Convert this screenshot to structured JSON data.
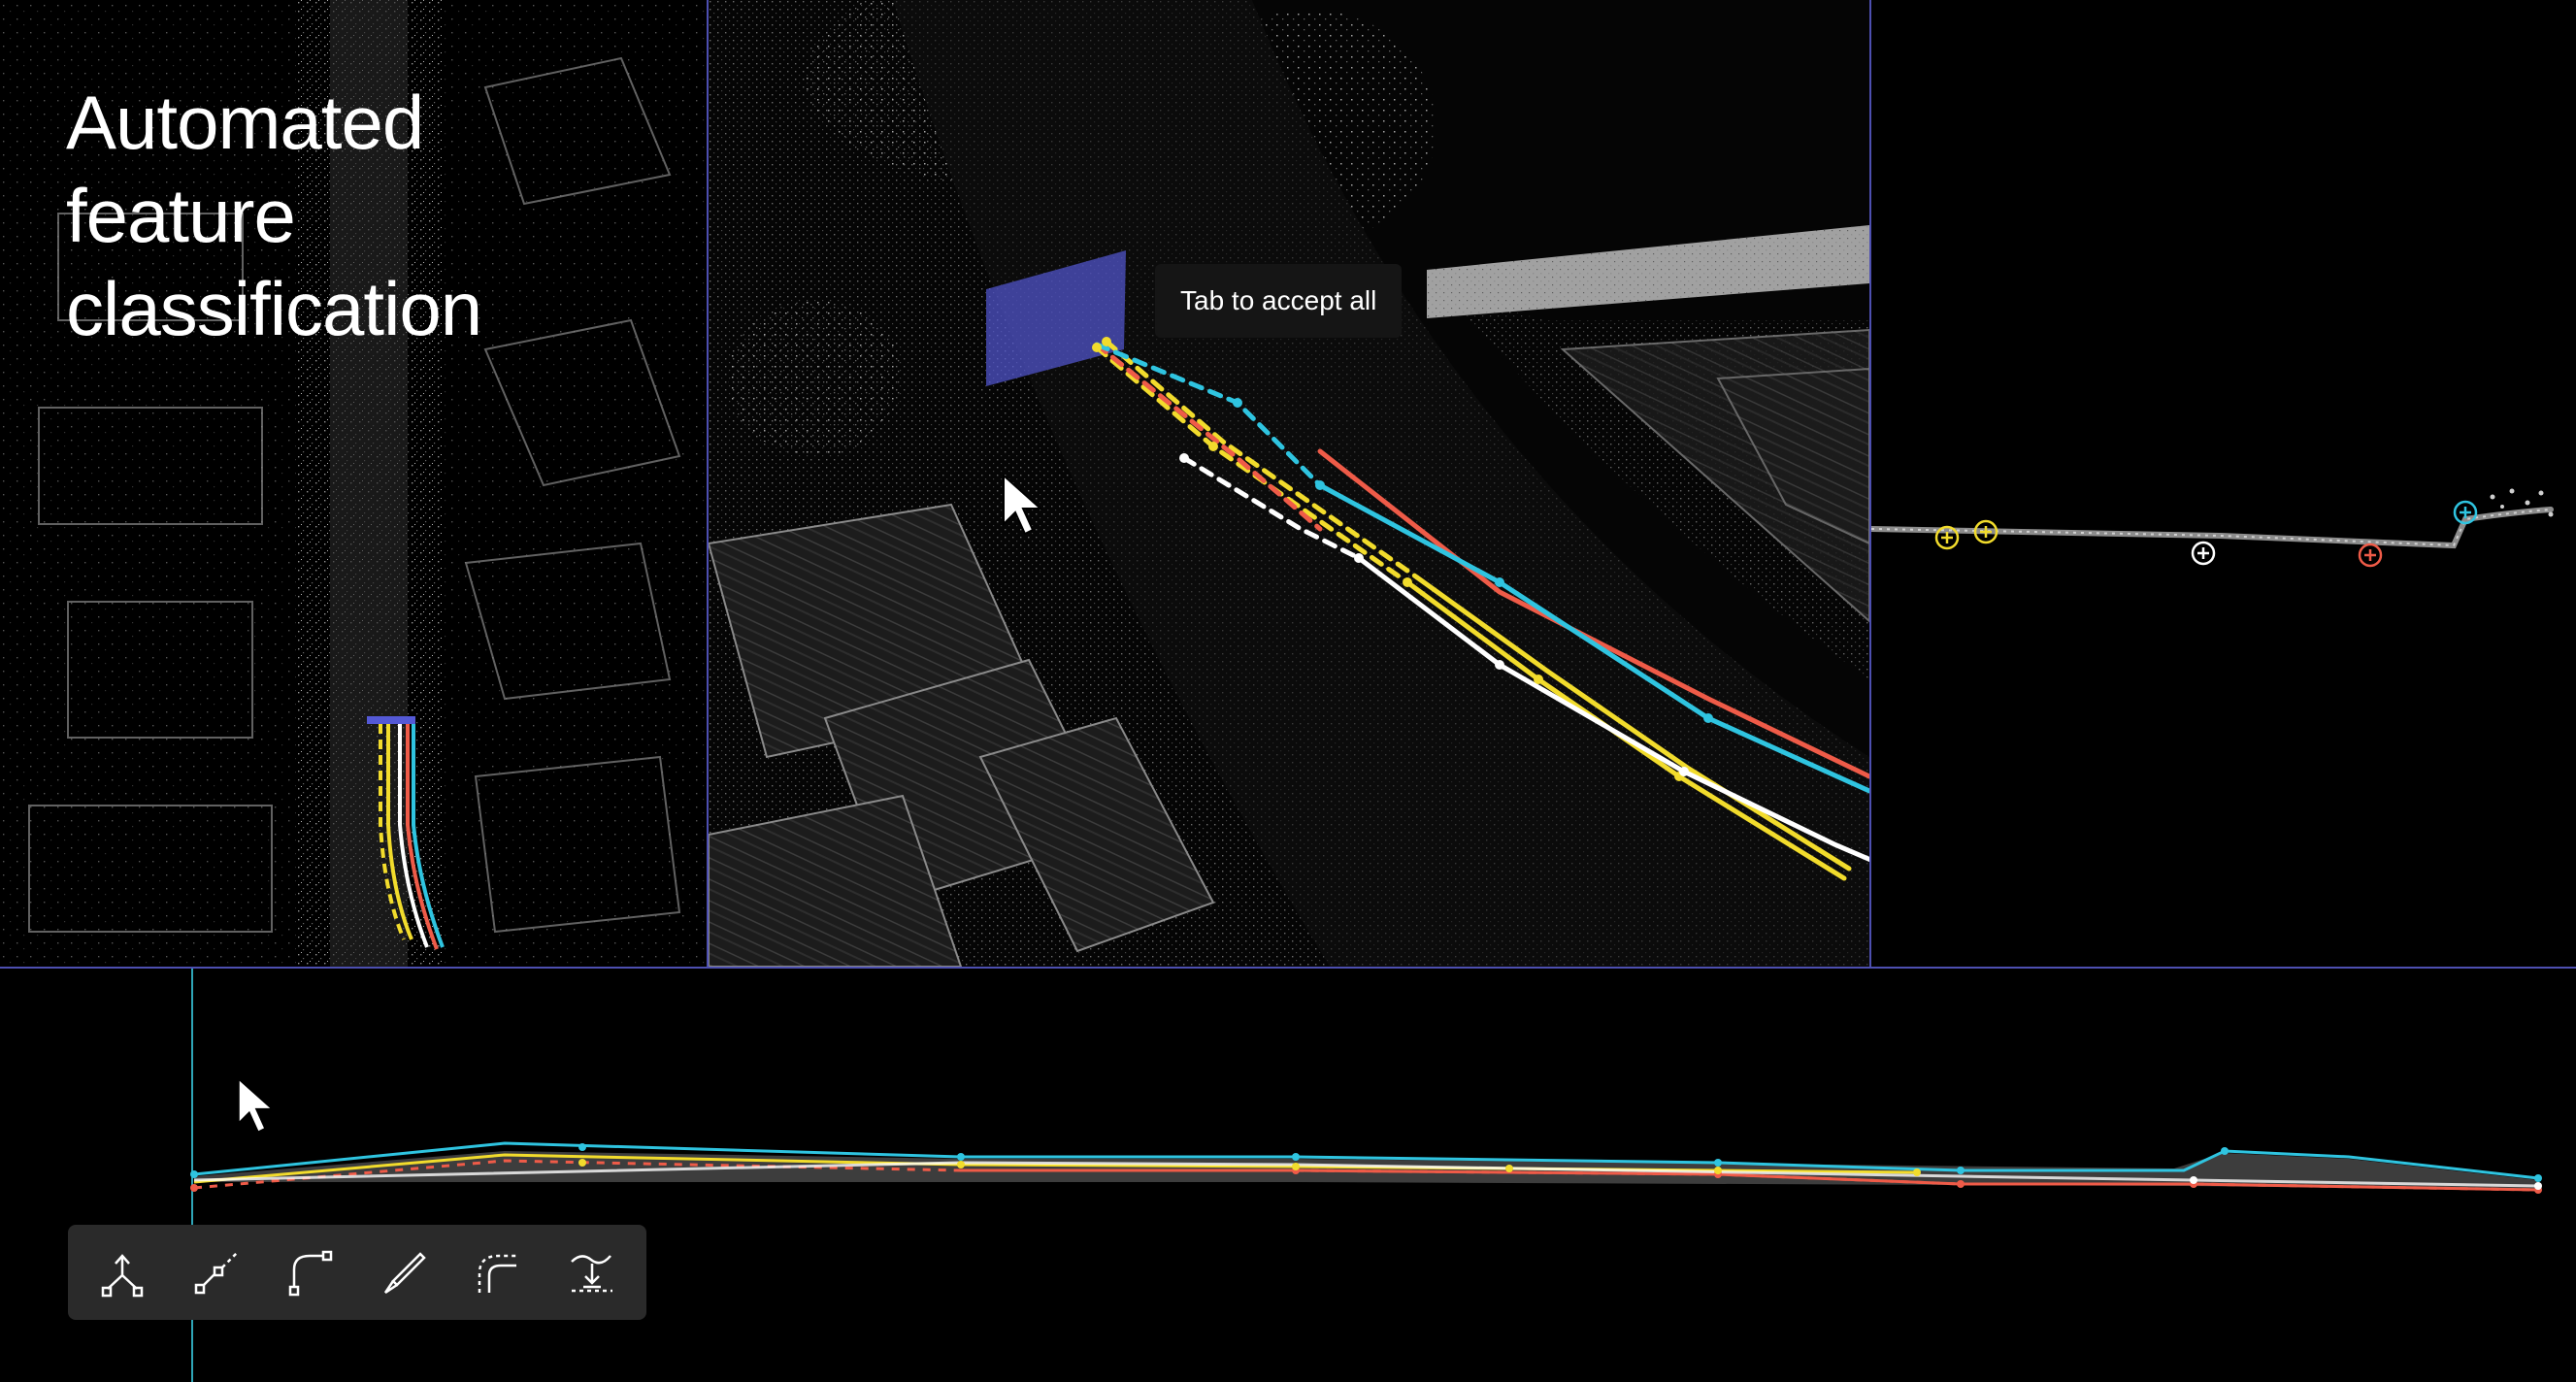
{
  "headline": {
    "line1": "Automated",
    "line2": "feature",
    "line3": "classification"
  },
  "tooltip": {
    "text": "Tab to accept all"
  },
  "toolbar": {
    "tools": [
      {
        "icon": "branch-split-icon"
      },
      {
        "icon": "dashed-line-segment-icon"
      },
      {
        "icon": "corner-curve-icon"
      },
      {
        "icon": "knife-cut-icon"
      },
      {
        "icon": "dashed-curve-offset-icon"
      },
      {
        "icon": "surface-drop-icon"
      }
    ]
  },
  "feature_colors": {
    "curb_top": "#2fc4e0",
    "curb_bottom": "#ef5b48",
    "lane_edge": "#ffffff",
    "centerline": "#f2dc2c",
    "selection_plane": "#5459d6",
    "panel_divider": "#4d4fb0"
  }
}
